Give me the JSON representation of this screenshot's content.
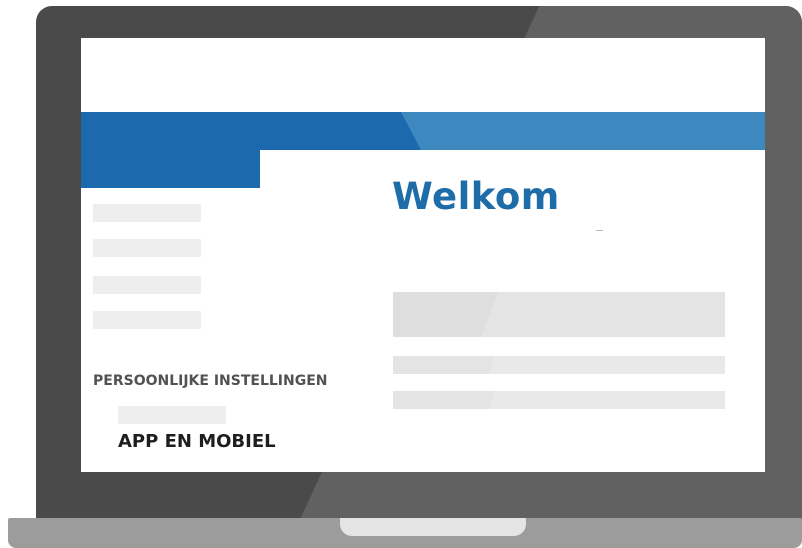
{
  "main": {
    "title": "Welkom"
  },
  "sidebar": {
    "settings_heading": "PERSOONLIJKE INSTELLINGEN",
    "app_item_label": "APP EN MOBIEL"
  },
  "colors": {
    "header_light": "#3c88bf",
    "header_dark": "#1c6aad",
    "title": "#1e6ca8",
    "laptop_frame": "#4a4a4a",
    "laptop_base": "#9c9c9c",
    "placeholder": "#eeeeee",
    "content_placeholder": "#dedede"
  }
}
